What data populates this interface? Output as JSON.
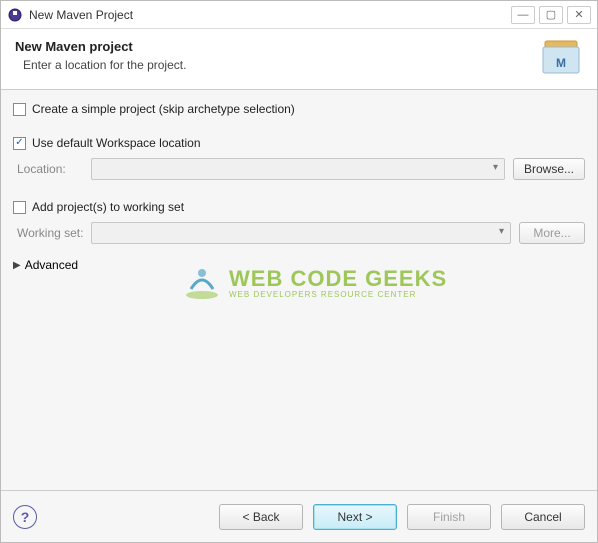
{
  "titlebar": {
    "title": "New Maven Project"
  },
  "header": {
    "title": "New Maven project",
    "subtitle": "Enter a location for the project."
  },
  "options": {
    "simpleProject": {
      "label": "Create a simple project (skip archetype selection)",
      "checked": false
    },
    "useDefaultWorkspace": {
      "label": "Use default Workspace location",
      "checked": true
    },
    "locationLabel": "Location:",
    "browseLabel": "Browse...",
    "addToWorkingSet": {
      "label": "Add project(s) to working set",
      "checked": false
    },
    "workingSetLabel": "Working set:",
    "moreLabel": "More...",
    "advancedLabel": "Advanced"
  },
  "watermark": {
    "main": "WEB CODE GEEKS",
    "sub": "WEB DEVELOPERS RESOURCE CENTER"
  },
  "footer": {
    "back": "< Back",
    "next": "Next >",
    "finish": "Finish",
    "cancel": "Cancel"
  }
}
